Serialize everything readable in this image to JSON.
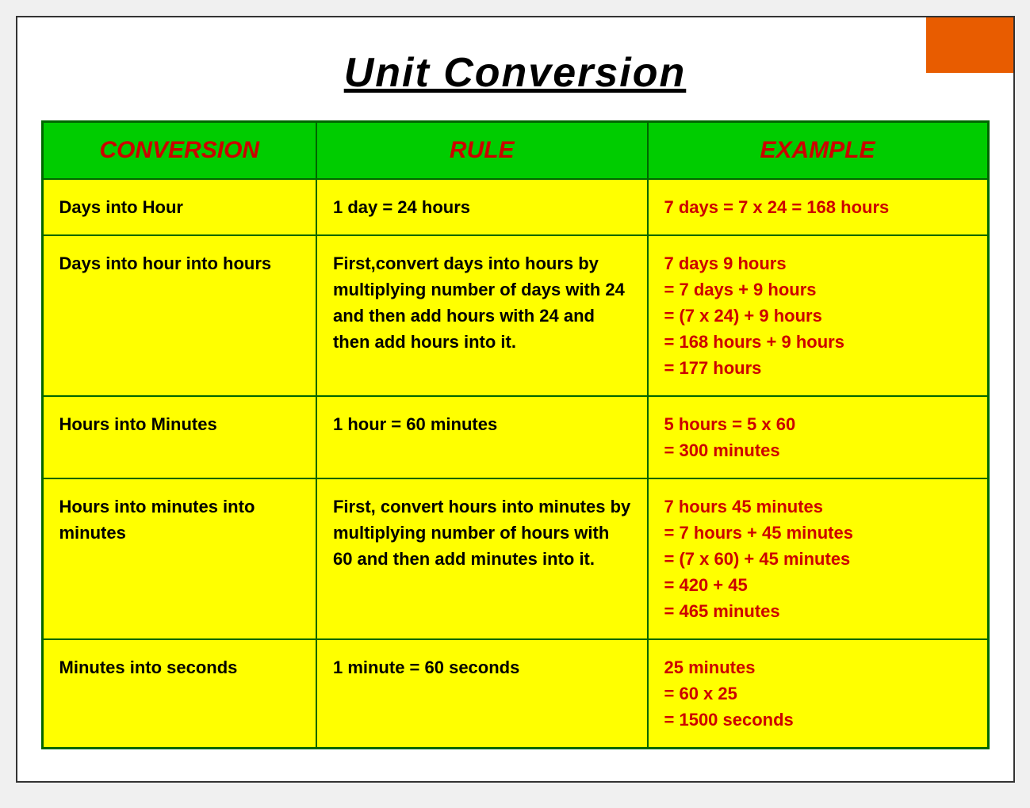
{
  "page": {
    "title": "Unit Conversion",
    "orange_corner": true
  },
  "table": {
    "headers": {
      "col1": "CONVERSION",
      "col2": "RULE",
      "col3": "EXAMPLE"
    },
    "rows": [
      {
        "conversion": "Days into Hour",
        "rule": "1 day = 24 hours",
        "example": "7 days = 7 x 24 = 168 hours"
      },
      {
        "conversion": "Days into hour into hours",
        "rule": "First,convert days into hours by multiplying number of days with 24 and then add hours with 24 and then add hours into it.",
        "example": "7 days 9 hours\n= 7 days + 9 hours\n= (7 x 24) + 9 hours\n= 168 hours + 9 hours\n= 177 hours"
      },
      {
        "conversion": "Hours into Minutes",
        "rule": "1 hour = 60 minutes",
        "example": "5 hours = 5 x 60\n= 300 minutes"
      },
      {
        "conversion": "Hours into minutes into minutes",
        "rule": "First, convert hours into minutes by multiplying number of hours with 60 and then add minutes into it.",
        "example": "7 hours 45 minutes\n= 7 hours + 45 minutes\n= (7 x 60) + 45 minutes\n= 420 + 45\n= 465 minutes"
      },
      {
        "conversion": "Minutes into seconds",
        "rule": "1 minute = 60 seconds",
        "example": "25 minutes\n= 60 x 25\n= 1500 seconds"
      }
    ]
  }
}
